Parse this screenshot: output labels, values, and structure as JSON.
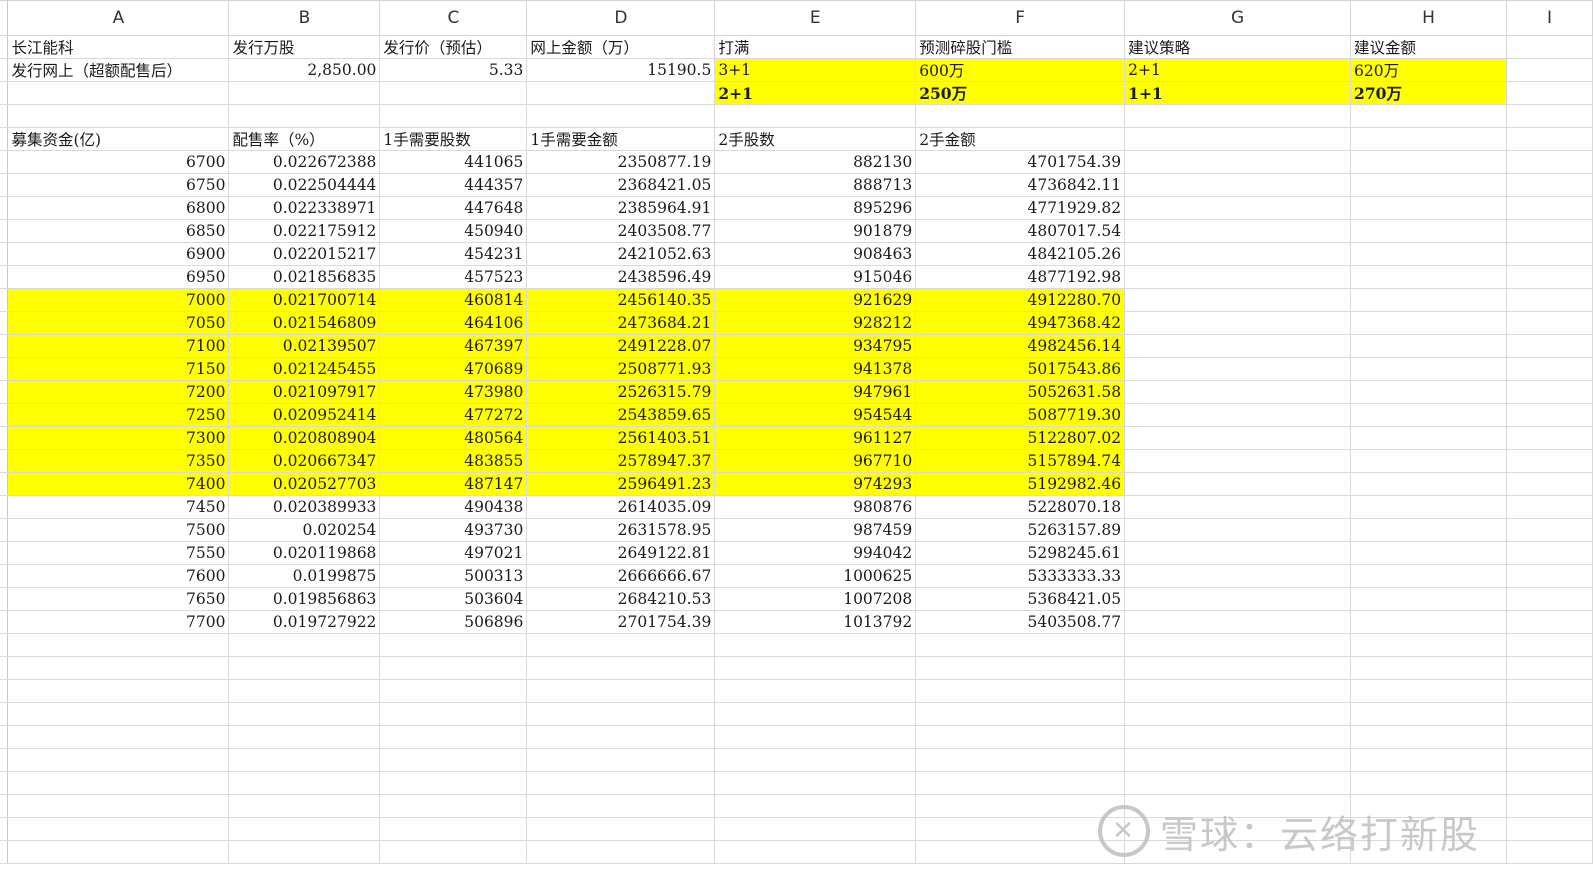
{
  "columns": [
    "A",
    "B",
    "C",
    "D",
    "E",
    "F",
    "G",
    "H",
    "I"
  ],
  "rows": [
    {
      "cells": [
        {
          "v": "长江能科",
          "a": "l"
        },
        {
          "v": "发行万股",
          "a": "l"
        },
        {
          "v": "发行价（预估）",
          "a": "l"
        },
        {
          "v": "网上金额（万）",
          "a": "l"
        },
        {
          "v": "打满",
          "a": "l"
        },
        {
          "v": "预测碎股门槛",
          "a": "l"
        },
        {
          "v": "建议策略",
          "a": "l"
        },
        {
          "v": "建议金额",
          "a": "l"
        },
        {
          "v": ""
        }
      ]
    },
    {
      "cells": [
        {
          "v": "发行网上（超额配售后）",
          "a": "l"
        },
        {
          "v": "2,850.00",
          "a": "r"
        },
        {
          "v": "5.33",
          "a": "r"
        },
        {
          "v": "15190.5",
          "a": "r"
        },
        {
          "v": "3+1",
          "a": "l",
          "hl": true
        },
        {
          "v": "600万",
          "a": "l",
          "hl": true
        },
        {
          "v": "2+1",
          "a": "l",
          "hl": true
        },
        {
          "v": "620万",
          "a": "l",
          "hl": true
        },
        {
          "v": ""
        }
      ]
    },
    {
      "cells": [
        {
          "v": ""
        },
        {
          "v": ""
        },
        {
          "v": ""
        },
        {
          "v": ""
        },
        {
          "v": "2+1",
          "a": "l",
          "hl": true,
          "b": true
        },
        {
          "v": "250万",
          "a": "l",
          "hl": true,
          "b": true
        },
        {
          "v": "1+1",
          "a": "l",
          "hl": true,
          "b": true
        },
        {
          "v": "270万",
          "a": "l",
          "hl": true,
          "b": true
        },
        {
          "v": ""
        }
      ]
    },
    {
      "cells": [
        {
          "v": ""
        },
        {
          "v": ""
        },
        {
          "v": ""
        },
        {
          "v": ""
        },
        {
          "v": ""
        },
        {
          "v": ""
        },
        {
          "v": ""
        },
        {
          "v": ""
        },
        {
          "v": ""
        }
      ]
    },
    {
      "cells": [
        {
          "v": "募集资金(亿)",
          "a": "l"
        },
        {
          "v": "配售率（%）",
          "a": "l"
        },
        {
          "v": "1手需要股数",
          "a": "l"
        },
        {
          "v": "1手需要金额",
          "a": "l"
        },
        {
          "v": "2手股数",
          "a": "l"
        },
        {
          "v": "2手金额",
          "a": "l"
        },
        {
          "v": ""
        },
        {
          "v": ""
        },
        {
          "v": ""
        }
      ]
    },
    {
      "d": [
        "6700",
        "0.022672388",
        "441065",
        "2350877.19",
        "882130",
        "4701754.39"
      ]
    },
    {
      "d": [
        "6750",
        "0.022504444",
        "444357",
        "2368421.05",
        "888713",
        "4736842.11"
      ]
    },
    {
      "d": [
        "6800",
        "0.022338971",
        "447648",
        "2385964.91",
        "895296",
        "4771929.82"
      ]
    },
    {
      "d": [
        "6850",
        "0.022175912",
        "450940",
        "2403508.77",
        "901879",
        "4807017.54"
      ]
    },
    {
      "d": [
        "6900",
        "0.022015217",
        "454231",
        "2421052.63",
        "908463",
        "4842105.26"
      ]
    },
    {
      "d": [
        "6950",
        "0.021856835",
        "457523",
        "2438596.49",
        "915046",
        "4877192.98"
      ]
    },
    {
      "d": [
        "7000",
        "0.021700714",
        "460814",
        "2456140.35",
        "921629",
        "4912280.70"
      ],
      "hl": true
    },
    {
      "d": [
        "7050",
        "0.021546809",
        "464106",
        "2473684.21",
        "928212",
        "4947368.42"
      ],
      "hl": true
    },
    {
      "d": [
        "7100",
        "0.02139507",
        "467397",
        "2491228.07",
        "934795",
        "4982456.14"
      ],
      "hl": true
    },
    {
      "d": [
        "7150",
        "0.021245455",
        "470689",
        "2508771.93",
        "941378",
        "5017543.86"
      ],
      "hl": true
    },
    {
      "d": [
        "7200",
        "0.021097917",
        "473980",
        "2526315.79",
        "947961",
        "5052631.58"
      ],
      "hl": true
    },
    {
      "d": [
        "7250",
        "0.020952414",
        "477272",
        "2543859.65",
        "954544",
        "5087719.30"
      ],
      "hl": true
    },
    {
      "d": [
        "7300",
        "0.020808904",
        "480564",
        "2561403.51",
        "961127",
        "5122807.02"
      ],
      "hl": true
    },
    {
      "d": [
        "7350",
        "0.020667347",
        "483855",
        "2578947.37",
        "967710",
        "5157894.74"
      ],
      "hl": true
    },
    {
      "d": [
        "7400",
        "0.020527703",
        "487147",
        "2596491.23",
        "974293",
        "5192982.46"
      ],
      "hl": true
    },
    {
      "d": [
        "7450",
        "0.020389933",
        "490438",
        "2614035.09",
        "980876",
        "5228070.18"
      ]
    },
    {
      "d": [
        "7500",
        "0.020254",
        "493730",
        "2631578.95",
        "987459",
        "5263157.89"
      ]
    },
    {
      "d": [
        "7550",
        "0.020119868",
        "497021",
        "2649122.81",
        "994042",
        "5298245.61"
      ]
    },
    {
      "d": [
        "7600",
        "0.0199875",
        "500313",
        "2666666.67",
        "1000625",
        "5333333.33"
      ]
    },
    {
      "d": [
        "7650",
        "0.019856863",
        "503604",
        "2684210.53",
        "1007208",
        "5368421.05"
      ]
    },
    {
      "d": [
        "7700",
        "0.019727922",
        "506896",
        "2701754.39",
        "1013792",
        "5403508.77"
      ]
    }
  ],
  "empty_rows": 10,
  "watermark": {
    "icon": "xueqiu-logo-icon",
    "text": "雪球：云络打新股"
  },
  "colors": {
    "highlight": "#ffff00",
    "grid": "#d9d9d9"
  }
}
